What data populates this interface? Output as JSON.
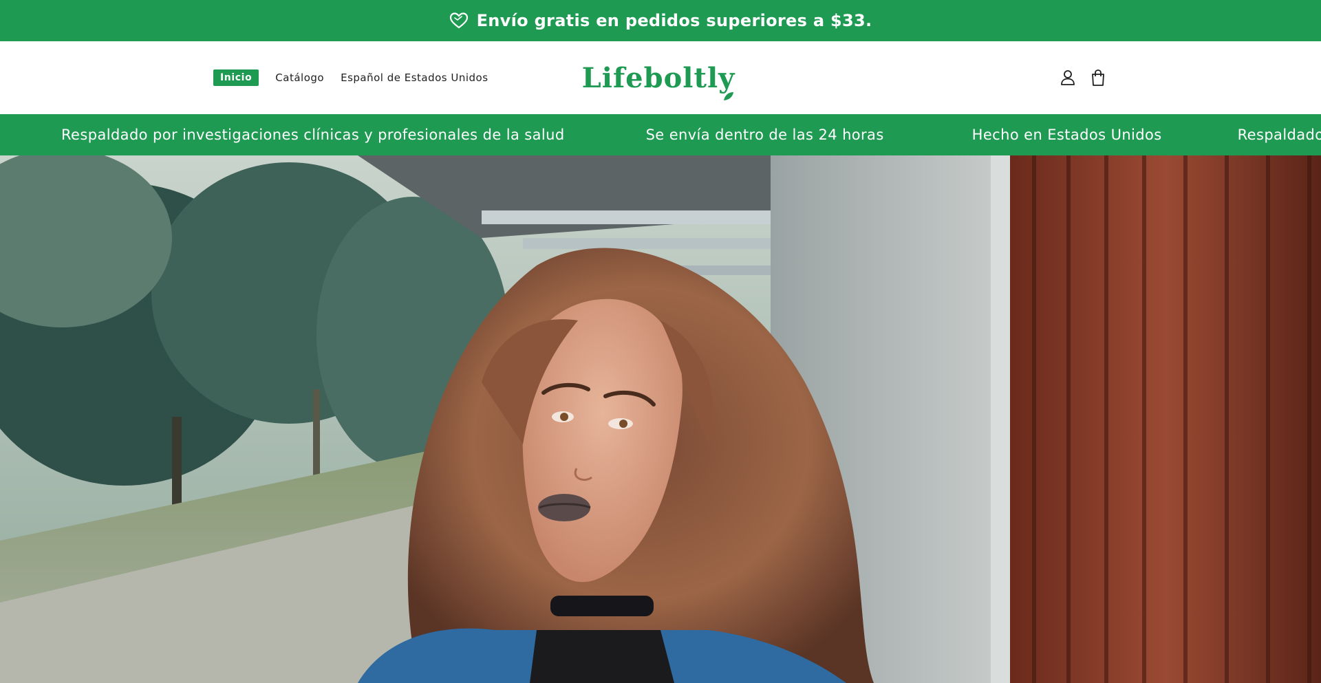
{
  "announcement": {
    "text": "Envío gratis en pedidos superiores a $33.",
    "icon": "heart-outline-icon"
  },
  "header": {
    "nav": [
      {
        "label": "Inicio",
        "active": true
      },
      {
        "label": "Catálogo",
        "active": false
      },
      {
        "label": "Español de Estados Unidos",
        "active": false
      }
    ],
    "logo_text": "Lifeboltly",
    "icons": [
      "account-icon",
      "cart-icon"
    ]
  },
  "marquee": {
    "items": [
      "Respaldado por investigaciones clínicas y profesionales de la salud",
      "Se envía dentro de las 24 horas",
      "Hecho en Estados Unidos",
      "Respaldado"
    ]
  },
  "hero": {
    "image": "woman-curly-hair-outdoor-photo"
  },
  "colors": {
    "brand_green": "#1e9a52",
    "text": "#1e1e1e",
    "background": "#ffffff"
  }
}
